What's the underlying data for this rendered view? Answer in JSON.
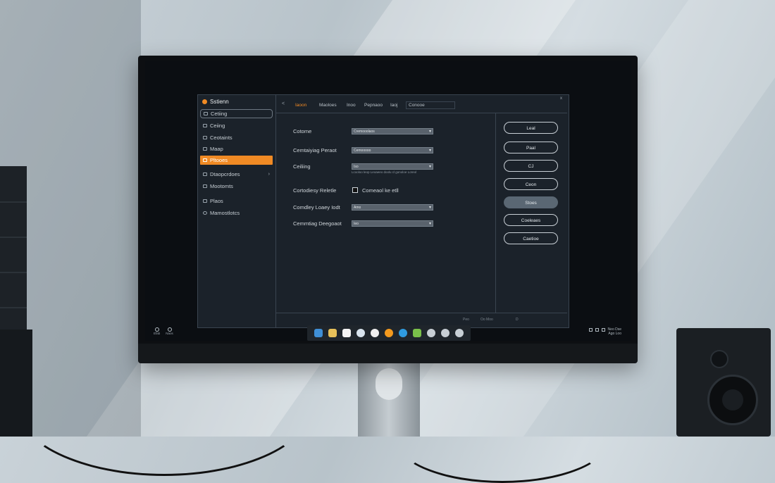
{
  "app": {
    "title": "Sstienn"
  },
  "sidebar": {
    "items": [
      {
        "label": "Cetiing",
        "style": "boxed"
      },
      {
        "label": "Ceiing",
        "style": "normal"
      },
      {
        "label": "Ceotaints",
        "style": "normal"
      },
      {
        "label": "Maap",
        "style": "normal"
      },
      {
        "label": "Pltooes",
        "style": "active"
      },
      {
        "label": "Dtaopcrdoes",
        "style": "normal",
        "has_chevron": true
      },
      {
        "label": "Mootomts",
        "style": "normal"
      },
      {
        "label": "Plaos",
        "style": "normal"
      },
      {
        "label": "Mamostlotcs",
        "style": "normal"
      }
    ]
  },
  "tabs": {
    "back": "<",
    "items": [
      "Iaoon",
      "Maoloes",
      "Inoo",
      "Pepnaoo",
      "Iaoj"
    ],
    "active_index": 0,
    "search": "Conooe",
    "close": "x"
  },
  "form": {
    "fields": [
      {
        "label": "Cotome",
        "value": "Cremooolaos"
      },
      {
        "label": "Cemtaiyiag Peraot",
        "value": "Cemooooo"
      },
      {
        "label": "Ceiliing",
        "value": "Iso",
        "hint": "Lcooloo leop Leoaeeo doolu cl gonoloe Loreol"
      },
      {
        "label": "Cortodiesy Reletle",
        "checkbox_label": "Comeaol ke etll",
        "checked": false
      },
      {
        "label": "Comdley Loaey Iodt",
        "value": "Amo"
      },
      {
        "label": "Cemmtiag Deegoaot",
        "value": "Ieo"
      }
    ]
  },
  "actions": {
    "buttons": [
      {
        "label": "Leal",
        "filled": false
      },
      {
        "label": "Paal",
        "filled": false
      },
      {
        "label": "CJ",
        "filled": false
      },
      {
        "label": "Ceon",
        "filled": false
      },
      {
        "label": "Stoes",
        "filled": true
      },
      {
        "label": "Coeleaes",
        "filled": false
      },
      {
        "label": "Caetioe",
        "filled": false
      }
    ]
  },
  "statusbar": {
    "left": "Peo",
    "middle": "Oo Moo",
    "right": "D"
  },
  "taskbar": {
    "left_items": [
      "Efab",
      "Naos"
    ],
    "apps": [
      {
        "name": "window-icon",
        "color": "#3f8fd6"
      },
      {
        "name": "folder-icon",
        "color": "#e8c15a"
      },
      {
        "name": "document-icon",
        "color": "#f4f4f4"
      },
      {
        "name": "browser-icon",
        "color": "#d9e4ee"
      },
      {
        "name": "clock-icon",
        "color": "#f0f0f0"
      },
      {
        "name": "settings-icon",
        "color": "#f39a1e"
      },
      {
        "name": "globe-icon",
        "color": "#2f9be0"
      },
      {
        "name": "store-icon",
        "color": "#7ac04a"
      },
      {
        "name": "gear-icon",
        "color": "#c8cfd5"
      },
      {
        "name": "camera-icon",
        "color": "#c8cfd5"
      },
      {
        "name": "music-icon",
        "color": "#c8cfd5"
      }
    ],
    "clock": {
      "time": "Neo Dse",
      "date": "Ago Loo"
    }
  },
  "colors": {
    "accent": "#f08a24",
    "window_bg": "#1b222a",
    "border": "#3a4450"
  }
}
